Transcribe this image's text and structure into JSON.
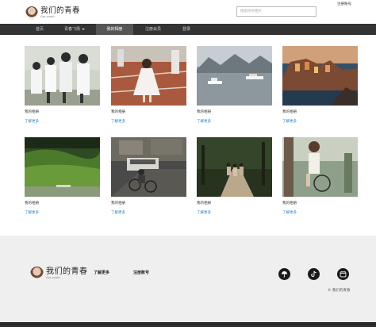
{
  "header": {
    "logo_cn": "我们的青春",
    "logo_en": "Our youth",
    "search_placeholder": "搜索你的相片",
    "register_link": "注册账号"
  },
  "nav": {
    "items": [
      {
        "label": "首页"
      },
      {
        "label": "青春飞扬"
      },
      {
        "label": "我的相册"
      },
      {
        "label": "注册会员"
      },
      {
        "label": "登录"
      }
    ],
    "active_index": 2
  },
  "gallery": {
    "cards": [
      {
        "title": "我的相册",
        "more": "了解更多",
        "scene": "students-group"
      },
      {
        "title": "我的相册",
        "more": "了解更多",
        "scene": "girl-white-dress"
      },
      {
        "title": "我的相册",
        "more": "了解更多",
        "scene": "lake-boats"
      },
      {
        "title": "我的相册",
        "more": "了解更多",
        "scene": "coastal-town-dusk"
      },
      {
        "title": "我的相册",
        "more": "了解更多",
        "scene": "green-valley"
      },
      {
        "title": "我的相册",
        "more": "了解更多",
        "scene": "street-cyclist"
      },
      {
        "title": "我的相册",
        "more": "了解更多",
        "scene": "people-walking-park"
      },
      {
        "title": "我的相册",
        "more": "了解更多",
        "scene": "girl-bicycle"
      }
    ]
  },
  "footer": {
    "logo_cn": "我们的青春",
    "logo_en": "Our youth",
    "learn_more": "了解更多",
    "register": "注册账号",
    "social_icons": [
      "umbrella-icon",
      "tiktok-icon",
      "calendar-icon"
    ],
    "copyright": "© 我们的青春"
  },
  "colors": {
    "nav_bg": "#333333",
    "nav_active_bg": "#555555",
    "link_blue": "#1f7fc4",
    "footer_bg": "#efefef"
  }
}
